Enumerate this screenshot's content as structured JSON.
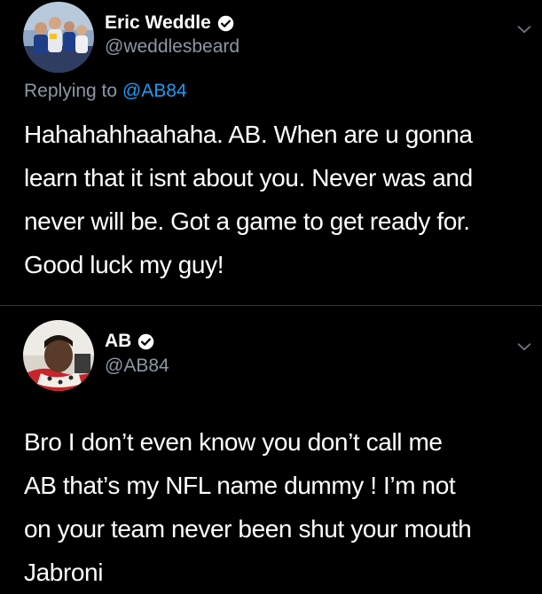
{
  "tweets": [
    {
      "display_name": "Eric Weddle",
      "handle": "@weddlesbeard",
      "verified": true,
      "replying_to_prefix": "Replying to ",
      "replying_to_handle": "@AB84",
      "text_lines": [
        "Hahahahhaahaha. AB. When are u gonna",
        "learn that it isnt about you. Never was and",
        "never will be. Got a game to get ready for.",
        "Good luck my guy!"
      ],
      "avatar_icon": "group-photo-avatar"
    },
    {
      "display_name": "AB",
      "handle": "@AB84",
      "verified": true,
      "text_lines": [
        "Bro I don’t even know you don’t call me",
        "AB that’s my NFL name dummy ! I’m not",
        "on your team never been shut your mouth",
        "Jabroni"
      ],
      "avatar_icon": "portrait-photo-avatar"
    }
  ],
  "icons": {
    "verified": "verified-badge-icon",
    "menu": "chevron-down-icon"
  },
  "colors": {
    "background": "#000000",
    "text": "#ffffff",
    "secondary_text": "#8b98a5",
    "link": "#1d9bf0",
    "divider": "#2f3336"
  }
}
